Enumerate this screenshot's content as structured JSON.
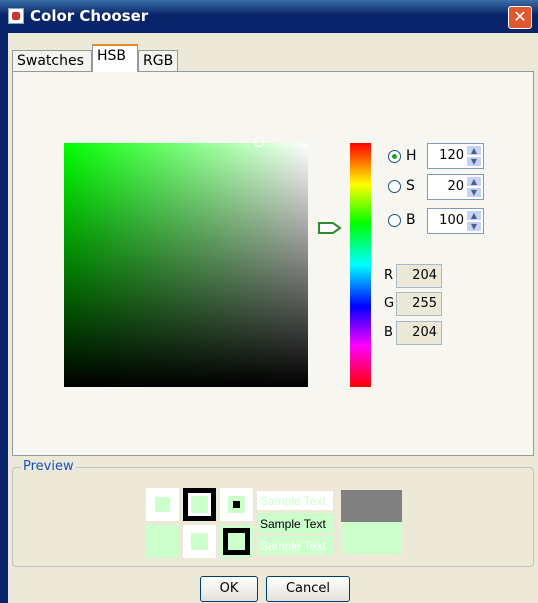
{
  "window": {
    "title": "Color Chooser",
    "close_label": "✕"
  },
  "tabs": [
    {
      "label": "Swatches",
      "active": false
    },
    {
      "label": "HSB",
      "active": true
    },
    {
      "label": "RGB",
      "active": false
    }
  ],
  "hsb": {
    "selected": "H",
    "fields": [
      {
        "label": "H",
        "value": "120"
      },
      {
        "label": "S",
        "value": "20"
      },
      {
        "label": "B",
        "value": "100"
      }
    ],
    "spinner_up_glyph": "▲",
    "spinner_down_glyph": "▼"
  },
  "rgb": [
    {
      "label": "R",
      "value": "204"
    },
    {
      "label": "G",
      "value": "255"
    },
    {
      "label": "B",
      "value": "204"
    }
  ],
  "preview": {
    "label": "Preview",
    "sample_text": "Sample Text",
    "swatch_color": "#ccffcc",
    "gray_color": "#808080"
  },
  "buttons": {
    "ok": "OK",
    "cancel": "Cancel"
  },
  "icons": {
    "close": "close-icon",
    "app": "java-cup-icon",
    "hue_pointer": "pointer-arrow-icon"
  }
}
